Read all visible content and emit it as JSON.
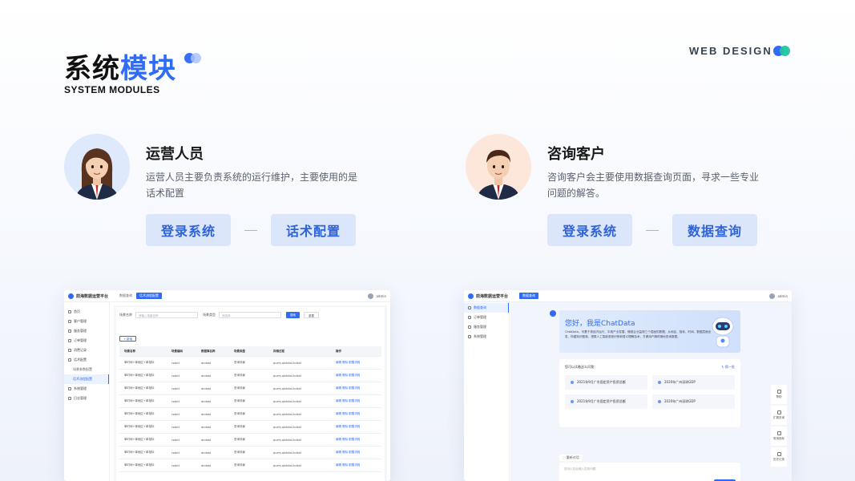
{
  "header": {
    "title_part1": "系统",
    "title_part2": "模块",
    "subtitle": "SYSTEM MODULES",
    "tag": "WEB DESIGN"
  },
  "colors": {
    "accent": "#2f6bf5",
    "teal": "#22c4a0",
    "pill_bg": "#dbe6fb"
  },
  "personas": [
    {
      "name": "运营人员",
      "description": "运营人员主要负责系统的运行维护，主要使用的是话术配置",
      "avatar_icon": "female-avatar",
      "actions": [
        "登录系统",
        "话术配置"
      ]
    },
    {
      "name": "咨询客户",
      "description": "咨询客户会主要使用数据查询页面，寻求一些专业问题的解答。",
      "avatar_icon": "male-avatar",
      "actions": [
        "登录系统",
        "数据查询"
      ]
    }
  ],
  "admin_screen": {
    "brand": "前海数据运营平台",
    "tabs": [
      "数据查询",
      "话术流程配置"
    ],
    "user": "admin",
    "sidebar": [
      {
        "label": "首页"
      },
      {
        "label": "客户管理"
      },
      {
        "label": "服务管理"
      },
      {
        "label": "订单管理"
      },
      {
        "label": "消费记录"
      },
      {
        "label": "话术配置"
      },
      {
        "label": "场景参数配置"
      },
      {
        "label": "话术流程配置"
      },
      {
        "label": "系统管理"
      },
      {
        "label": "日志管理"
      }
    ],
    "filter": {
      "label1": "场景名称",
      "placeholder1": "请输入场景名称",
      "label2": "场景类型",
      "placeholder2": "请选择",
      "search": "搜索",
      "reset": "重置"
    },
    "add_button": "+ 新增",
    "table": {
      "headers": [
        "场景名称",
        "场景编码",
        "数据库名称",
        "场景类型",
        "存储过程",
        "操作"
      ],
      "rows": [
        [
          "单时间+单地区+单指标",
          "code1",
          "qhdata",
          "查询场景",
          "query.qhdata.indext",
          "编辑 删除 配置流程"
        ],
        [
          "单时间+单地区+单指标",
          "code1",
          "qhdata",
          "查询场景",
          "query.qhdata.indext",
          "编辑 删除 配置流程"
        ],
        [
          "单时间+单地区+单指标",
          "code1",
          "qhdata",
          "查询场景",
          "query.qhdata.indext",
          "编辑 删除 配置流程"
        ],
        [
          "单时间+单地区+单指标",
          "code1",
          "qhdata",
          "查询场景",
          "query.qhdata.indext",
          "编辑 删除 配置流程"
        ],
        [
          "单时间+单地区+单指标",
          "code1",
          "qhdata",
          "查询场景",
          "query.qhdata.indext",
          "编辑 删除 配置流程"
        ],
        [
          "单时间+单地区+单指标",
          "code1",
          "qhdata",
          "查询场景",
          "query.qhdata.indext",
          "编辑 删除 配置流程"
        ],
        [
          "单时间+单地区+单指标",
          "code1",
          "qhdata",
          "查询场景",
          "query.qhdata.indext",
          "编辑 删除 配置流程"
        ],
        [
          "单时间+单地区+单指标",
          "code1",
          "qhdata",
          "查询场景",
          "query.qhdata.indext",
          "编辑 删除 配置流程"
        ],
        [
          "单时间+单地区+单指标",
          "code1",
          "qhdata",
          "查询场景",
          "query.qhdata.indext",
          "编辑 删除 配置流程"
        ]
      ]
    }
  },
  "chat_screen": {
    "brand": "前海数据运营平台",
    "tab": "数据查询",
    "user": "admin",
    "sidebar": [
      {
        "label": "数据查询"
      },
      {
        "label": "订单管理"
      },
      {
        "label": "服务管理"
      },
      {
        "label": "系统管理"
      }
    ],
    "greeting": "您好，我是ChatData",
    "intro": "ChatData，可基于现经济运行、中观产业发展、微观企业监测三个层面的数据，从地区、指标、时间、数据层面出发，构建知识图谱，搭载人工智能语音识别和语义理解技术，方便用户随时随地查询数据。",
    "question_header": "您可以试着这么问我：",
    "swap": "换一批",
    "questions": [
      "2021年9月广东固定资产投资总额",
      "2020年广州深圳GDP",
      "2021年9月广东固定资产投资总额",
      "2020年广州深圳GDP"
    ],
    "tools": [
      "帮助",
      "扩展查询",
      "常用指标",
      "历史记录"
    ],
    "new_chat": "重新对话",
    "input_placeholder": "您可以在此输入您的问题",
    "send": "发送"
  }
}
